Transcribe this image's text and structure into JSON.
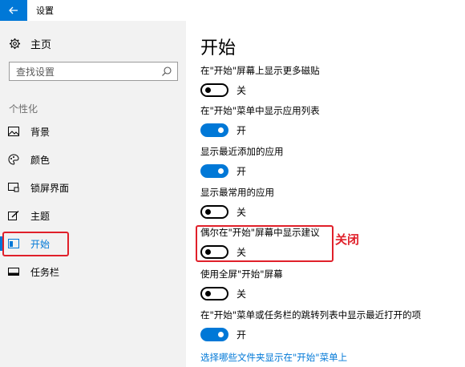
{
  "window": {
    "title": "设置"
  },
  "sidebar": {
    "home_label": "主页",
    "search_placeholder": "查找设置",
    "section_label": "个性化",
    "items": [
      {
        "label": "背景",
        "icon": "image-icon"
      },
      {
        "label": "颜色",
        "icon": "palette-icon"
      },
      {
        "label": "锁屏界面",
        "icon": "lock-screen-icon"
      },
      {
        "label": "主题",
        "icon": "theme-icon"
      },
      {
        "label": "开始",
        "icon": "start-icon",
        "active": true
      },
      {
        "label": "任务栏",
        "icon": "taskbar-icon"
      }
    ]
  },
  "main": {
    "title": "开始",
    "settings": [
      {
        "label": "在\"开始\"屏幕上显示更多磁贴",
        "state": "关",
        "on": false
      },
      {
        "label": "在\"开始\"菜单中显示应用列表",
        "state": "开",
        "on": true
      },
      {
        "label": "显示最近添加的应用",
        "state": "开",
        "on": true
      },
      {
        "label": "显示最常用的应用",
        "state": "关",
        "on": false
      },
      {
        "label": "偶尔在\"开始\"屏幕中显示建议",
        "state": "关",
        "on": false
      },
      {
        "label": "使用全屏\"开始\"屏幕",
        "state": "关",
        "on": false
      },
      {
        "label": "在\"开始\"菜单或任务栏的跳转列表中显示最近打开的项",
        "state": "开",
        "on": true
      }
    ],
    "link": "选择哪些文件夹显示在\"开始\"菜单上",
    "annotation": "关闭"
  },
  "colors": {
    "accent": "#0078d7",
    "annotation": "#e0202a"
  }
}
